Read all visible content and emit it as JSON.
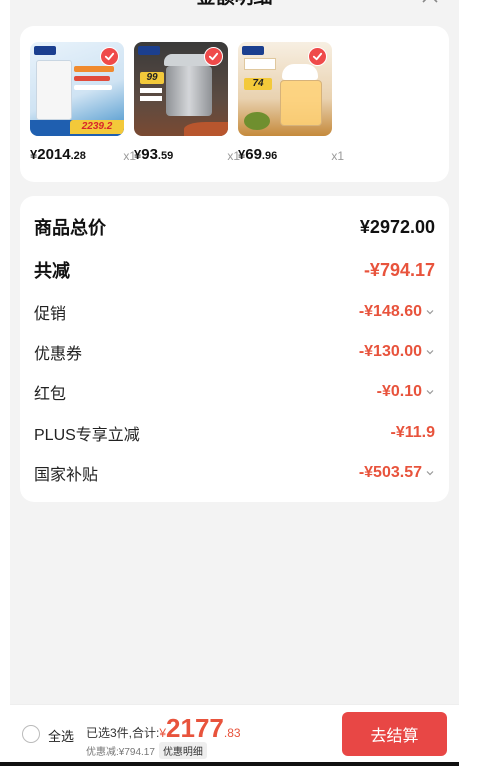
{
  "header": {
    "title": "金额明细"
  },
  "products": [
    {
      "currency": "¥",
      "price_int": "2014",
      "price_dec": ".28",
      "qty": "x1",
      "promo_price": "2239.2"
    },
    {
      "currency": "¥",
      "price_int": "93",
      "price_dec": ".59",
      "qty": "x1",
      "promo_price": "99"
    },
    {
      "currency": "¥",
      "price_int": "69",
      "price_dec": ".96",
      "qty": "x1",
      "promo_price": "74"
    }
  ],
  "summary": {
    "total_label": "商品总价",
    "total_value": "¥2972.00",
    "reduce_label": "共减",
    "reduce_value": "-¥794.17",
    "rows": [
      {
        "label": "促销",
        "value": "-¥148.60"
      },
      {
        "label": "优惠券",
        "value": "-¥130.00"
      },
      {
        "label": "红包",
        "value": "-¥0.10"
      },
      {
        "label": "PLUS专享立减",
        "value": "-¥11.9"
      },
      {
        "label": "国家补贴",
        "value": "-¥503.57"
      }
    ]
  },
  "footer": {
    "select_all": "全选",
    "selected_prefix": "已选3件,合计:",
    "currency": "¥",
    "total_int": "2177",
    "total_dec": ".83",
    "discount_text": "优惠减:¥794.17",
    "detail_label": "优惠明细",
    "checkout_label": "去结算"
  },
  "colors": {
    "accent": "#e8533c",
    "checkout_bg": "#e84745",
    "check_badge": "#ef4a4a"
  }
}
